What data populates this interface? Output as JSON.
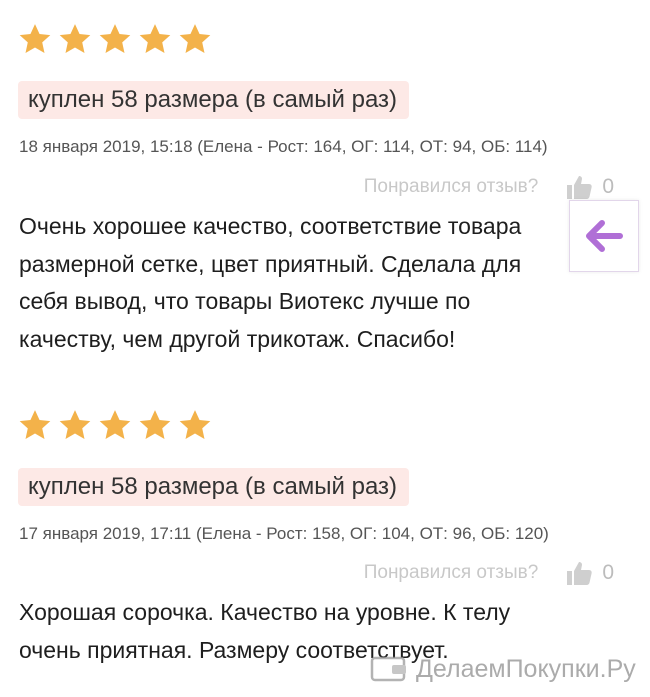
{
  "reviews": [
    {
      "rating": 5,
      "size_label": "куплен 58 размера (в самый раз)",
      "meta": "18 января 2019, 15:18 (Елена - Рост: 164, ОГ: 114, ОТ: 94, ОБ: 114)",
      "helpful_question": "Понравился отзыв?",
      "likes": "0",
      "text_lines": [
        "Очень хорошее качество, соответствие товара",
        "размерной сетке, цвет приятный. Сделала для",
        "себя вывод, что товары Виотекс лучше по",
        "качеству, чем другой трикотаж. Спасибо!"
      ]
    },
    {
      "rating": 5,
      "size_label": "куплен 58 размера (в самый раз)",
      "meta": "17 января 2019, 17:11 (Елена - Рост: 158, ОГ: 104, ОТ: 96, ОБ: 120)",
      "helpful_question": "Понравился отзыв?",
      "likes": "0",
      "text_lines": [
        "Хорошая сорочка. Качество на уровне. К телу",
        "очень приятная. Размеру соответствует."
      ]
    }
  ],
  "colors": {
    "star": "#f3b24a",
    "badge_bg": "#fde9e6",
    "back_arrow": "#b06fd6",
    "muted": "#c8c8c8"
  },
  "icons": {
    "star": "star-icon",
    "like": "thumbs-up-icon",
    "back": "arrow-left-icon",
    "watermark": "wallet-icon"
  },
  "watermark": {
    "text": "ДелаемПокупки.Ру"
  }
}
